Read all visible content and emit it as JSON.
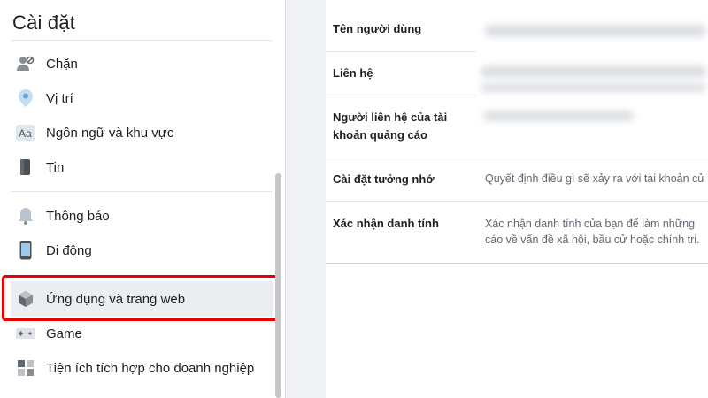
{
  "sidebar": {
    "title": "Cài đặt",
    "items": [
      {
        "label": "Chặn",
        "icon": "block-user-icon"
      },
      {
        "label": "Vị trí",
        "icon": "location-pin-icon"
      },
      {
        "label": "Ngôn ngữ và khu vực",
        "icon": "language-aa-icon"
      },
      {
        "label": "Tin",
        "icon": "stories-book-icon"
      },
      {
        "label": "Thông báo",
        "icon": "bell-icon"
      },
      {
        "label": "Di động",
        "icon": "mobile-phone-icon"
      },
      {
        "label": "Ứng dụng và trang web",
        "icon": "apps-cube-icon"
      },
      {
        "label": "Game",
        "icon": "game-controller-icon"
      },
      {
        "label": "Tiện ích tích hợp cho doanh nghiệp",
        "icon": "business-integration-icon"
      }
    ]
  },
  "settings": {
    "rows": [
      {
        "key": "Tên người dùng",
        "value": ""
      },
      {
        "key": "Liên hệ",
        "value": ""
      },
      {
        "key": "Người liên hệ của tài khoản quảng cáo",
        "key_line1": "Người liên hệ của tài",
        "key_line2": "khoản quảng cáo",
        "value": ""
      },
      {
        "key": "Cài đặt tưởng nhớ",
        "value": "Quyết định điều gì sẽ xảy ra với tài khoản củ"
      },
      {
        "key": "Xác nhận danh tính",
        "value_line1": "Xác nhận danh tính của bạn để làm những ",
        "value_line2": "cáo về vấn đề xã hội, bầu cử hoặc chính tri."
      }
    ]
  },
  "colors": {
    "highlight": "#e60000",
    "active_bg": "#ebedf0"
  }
}
